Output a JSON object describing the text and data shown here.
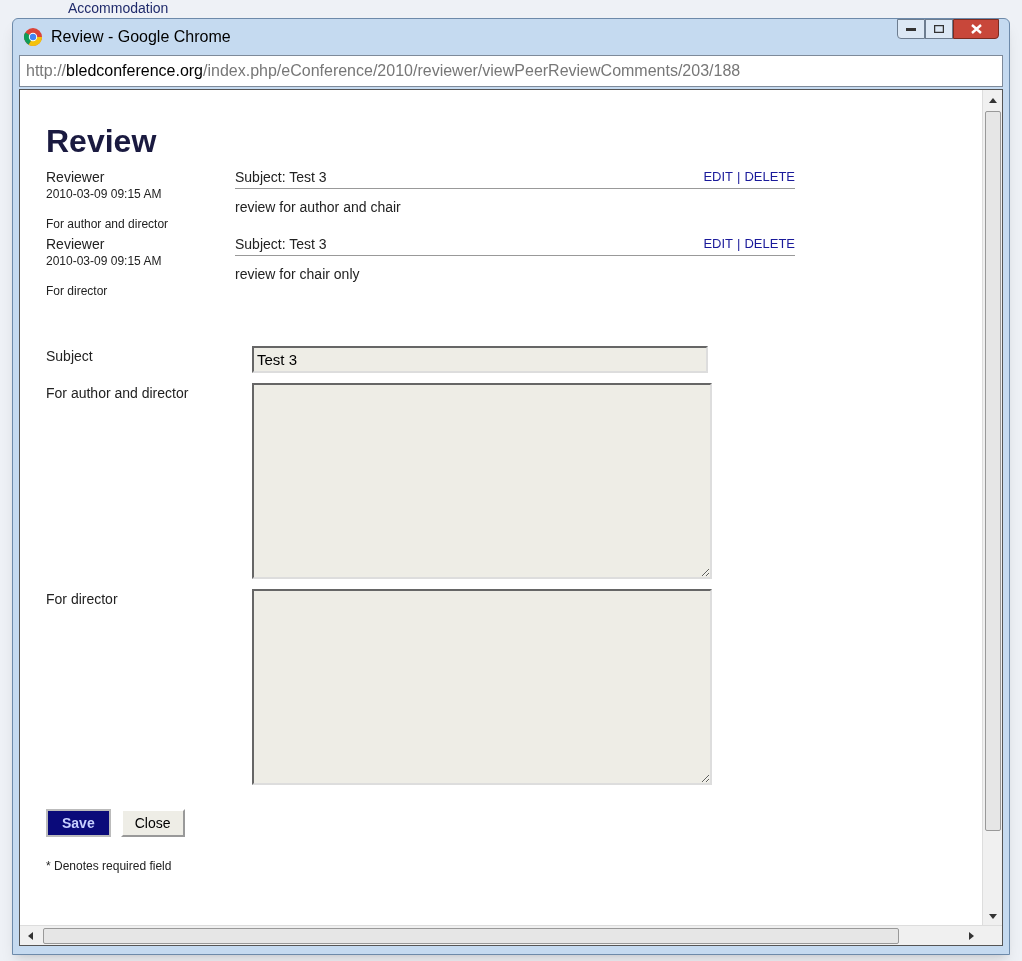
{
  "background": {
    "link": "Accommodation"
  },
  "window": {
    "title": "Review - Google Chrome"
  },
  "address_bar": {
    "prefix": "http://",
    "domain": "bledconference.org",
    "path": "/index.php/eConference/2010/reviewer/viewPeerReviewComments/203/188"
  },
  "page": {
    "heading": "Review",
    "reviews": [
      {
        "reviewer": "Reviewer",
        "date": "2010-03-09 09:15 AM",
        "audience": "For author and director",
        "subject": "Subject: Test 3",
        "edit": "EDIT",
        "separator": "|",
        "delete": "DELETE",
        "body": "review for author and chair"
      },
      {
        "reviewer": "Reviewer",
        "date": "2010-03-09 09:15 AM",
        "audience": "For director",
        "subject": "Subject: Test 3",
        "edit": "EDIT",
        "separator": "|",
        "delete": "DELETE",
        "body": "review for chair only"
      }
    ],
    "form": {
      "subject_label": "Subject",
      "subject_value": "Test 3",
      "author_label": "For author and director",
      "director_label": "For director"
    },
    "buttons": [
      {
        "label": "Save",
        "kind": "primary"
      },
      {
        "label": "Close",
        "kind": "secondary"
      }
    ],
    "footnote": "* Denotes required field"
  }
}
